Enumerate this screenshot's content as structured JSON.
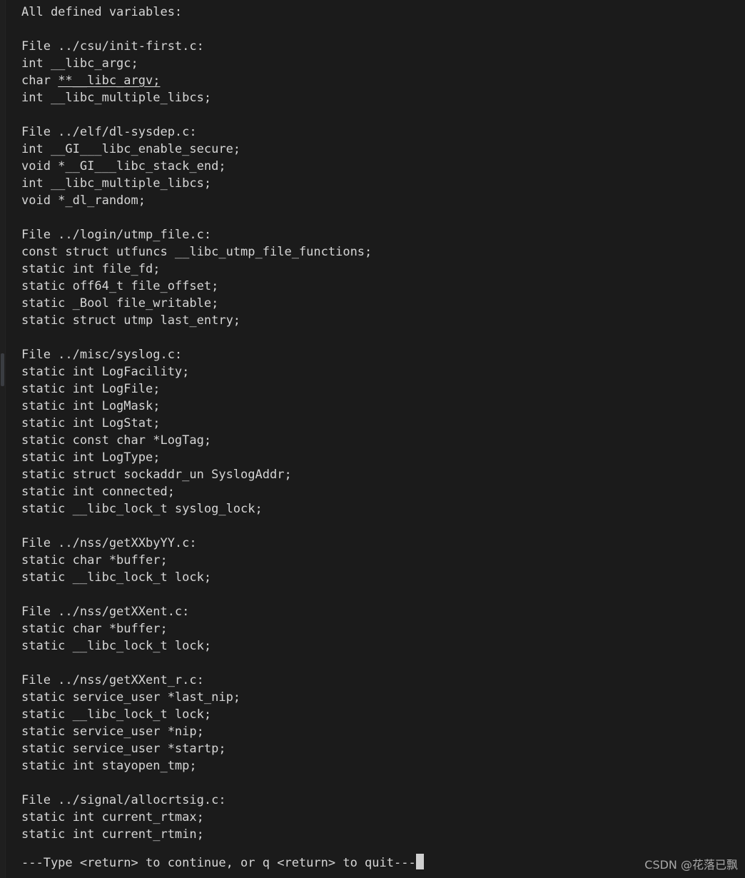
{
  "terminal": {
    "background_color": "#1b1b1b",
    "foreground_color": "#d6d6d6",
    "cursor_color": "#cfcfcf",
    "scrollbar_thumb_color": "#3a3d42"
  },
  "output": {
    "header": "All defined variables:",
    "blocks": [
      {
        "file_line": "File ../csu/init-first.c:",
        "entries": [
          {
            "text": "int __libc_argc;",
            "underlined": false
          },
          {
            "text": "char **__libc_argv;",
            "underlined": true,
            "underline_start": 5
          },
          {
            "text": "int __libc_multiple_libcs;",
            "underlined": false
          }
        ]
      },
      {
        "file_line": "File ../elf/dl-sysdep.c:",
        "entries": [
          {
            "text": "int __GI___libc_enable_secure;",
            "underlined": false
          },
          {
            "text": "void *__GI___libc_stack_end;",
            "underlined": false
          },
          {
            "text": "int __libc_multiple_libcs;",
            "underlined": false
          },
          {
            "text": "void *_dl_random;",
            "underlined": false
          }
        ]
      },
      {
        "file_line": "File ../login/utmp_file.c:",
        "entries": [
          {
            "text": "const struct utfuncs __libc_utmp_file_functions;",
            "underlined": false
          },
          {
            "text": "static int file_fd;",
            "underlined": false
          },
          {
            "text": "static off64_t file_offset;",
            "underlined": false
          },
          {
            "text": "static _Bool file_writable;",
            "underlined": false
          },
          {
            "text": "static struct utmp last_entry;",
            "underlined": false
          }
        ]
      },
      {
        "file_line": "File ../misc/syslog.c:",
        "entries": [
          {
            "text": "static int LogFacility;",
            "underlined": false
          },
          {
            "text": "static int LogFile;",
            "underlined": false
          },
          {
            "text": "static int LogMask;",
            "underlined": false
          },
          {
            "text": "static int LogStat;",
            "underlined": false
          },
          {
            "text": "static const char *LogTag;",
            "underlined": false
          },
          {
            "text": "static int LogType;",
            "underlined": false
          },
          {
            "text": "static struct sockaddr_un SyslogAddr;",
            "underlined": false
          },
          {
            "text": "static int connected;",
            "underlined": false
          },
          {
            "text": "static __libc_lock_t syslog_lock;",
            "underlined": false
          }
        ]
      },
      {
        "file_line": "File ../nss/getXXbyYY.c:",
        "entries": [
          {
            "text": "static char *buffer;",
            "underlined": false
          },
          {
            "text": "static __libc_lock_t lock;",
            "underlined": false
          }
        ]
      },
      {
        "file_line": "File ../nss/getXXent.c:",
        "entries": [
          {
            "text": "static char *buffer;",
            "underlined": false
          },
          {
            "text": "static __libc_lock_t lock;",
            "underlined": false
          }
        ]
      },
      {
        "file_line": "File ../nss/getXXent_r.c:",
        "entries": [
          {
            "text": "static service_user *last_nip;",
            "underlined": false
          },
          {
            "text": "static __libc_lock_t lock;",
            "underlined": false
          },
          {
            "text": "static service_user *nip;",
            "underlined": false
          },
          {
            "text": "static service_user *startp;",
            "underlined": false
          },
          {
            "text": "static int stayopen_tmp;",
            "underlined": false
          }
        ]
      },
      {
        "file_line": "File ../signal/allocrtsig.c:",
        "entries": [
          {
            "text": "static int current_rtmax;",
            "underlined": false
          },
          {
            "text": "static int current_rtmin;",
            "underlined": false
          }
        ]
      }
    ]
  },
  "pager_prompt": {
    "text": "---Type <return> to continue, or q <return> to quit---"
  },
  "watermark": {
    "text": "CSDN @花落已飘"
  }
}
